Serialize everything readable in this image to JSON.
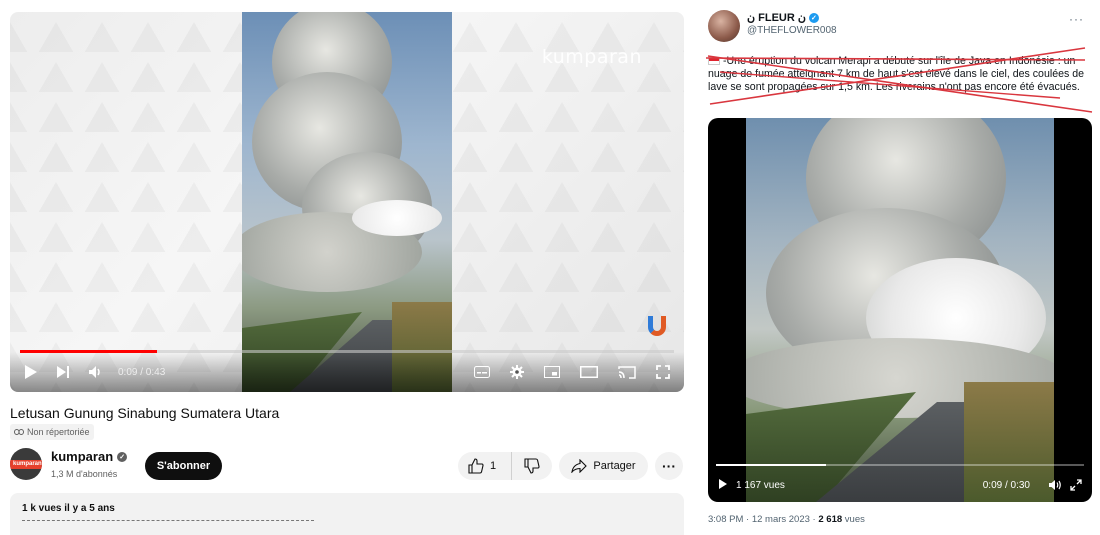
{
  "youtube": {
    "watermark": "kumparan",
    "time_display": "0:09 / 0:43",
    "progress_fraction": 0.21,
    "title": "Letusan Gunung Sinabung Sumatera Utara",
    "unlisted_label": "Non répertoriée",
    "channel": {
      "name": "kumparan",
      "subscribers": "1,3 M d'abonnés",
      "avatar_text": "kumparan"
    },
    "subscribe_label": "S'abonner",
    "like_count": "1",
    "share_label": "Partager",
    "description_meta": "1 k vues  il y a 5 ans",
    "icons": [
      "play-icon",
      "next-icon",
      "volume-icon",
      "subtitles-icon",
      "settings-icon",
      "miniplayer-icon",
      "theater-icon",
      "cast-icon",
      "fullscreen-icon",
      "thumbs-up-icon",
      "thumbs-down-icon",
      "share-icon",
      "more-icon"
    ]
  },
  "twitter": {
    "display_name": "ن FLEUR ن",
    "handle": "@THEFLOWER008",
    "more_label": "···",
    "tweet_text": "-Une éruption du volcan Merapi a débuté sur l'île de Java en Indonésie : un nuage de fumée atteignant 7 km de haut s'est élevé dans le ciel, des coulées de lave se sont propagées sur 1,5 km. Les riverains n'ont pas encore été évacués.",
    "video_views": "1 167 vues",
    "video_time": "0:09 / 0:30",
    "progress_fraction": 0.3,
    "posted": "3:08 PM · 12 mars 2023 ·",
    "total_views_count": "2 618",
    "total_views_label": "vues",
    "strike_color": "#d9363e",
    "accent": "#1d9bf0"
  }
}
